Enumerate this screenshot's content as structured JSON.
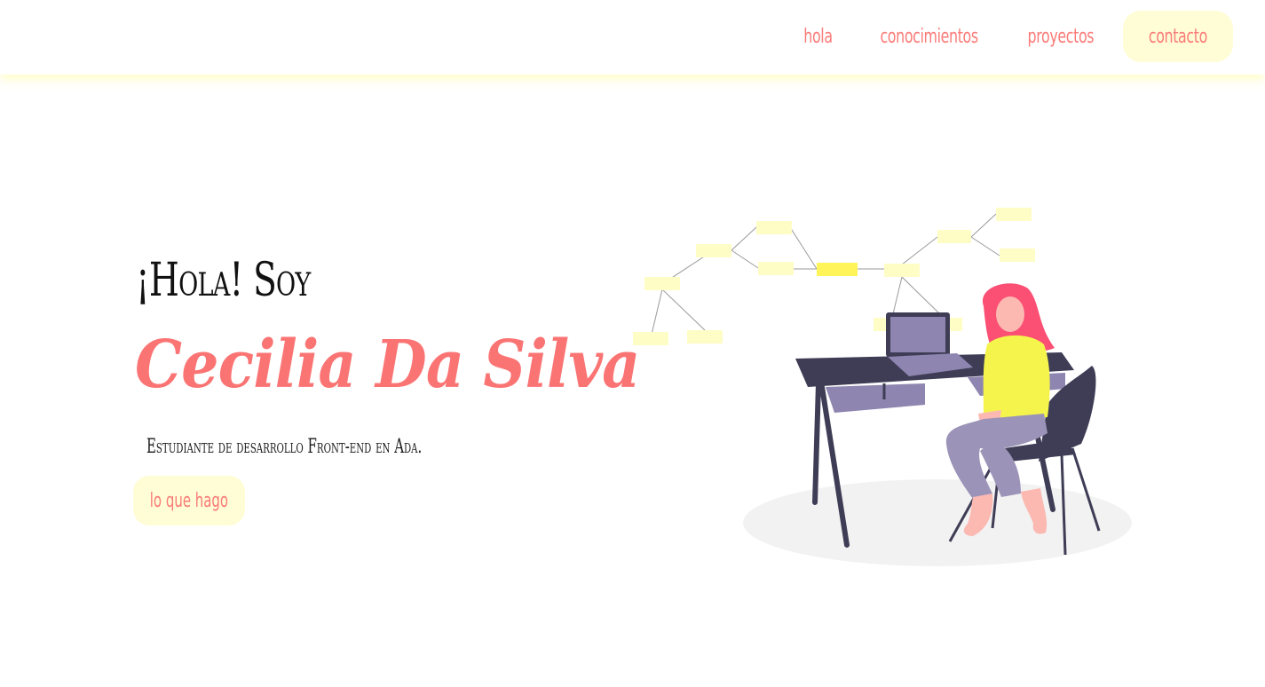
{
  "nav": {
    "items": [
      {
        "label": "hola"
      },
      {
        "label": "conocimientos"
      },
      {
        "label": "proyectos"
      },
      {
        "label": "contacto"
      }
    ]
  },
  "hero": {
    "greeting": "¡Hola! Soy",
    "name": "Cecilia Da Silva",
    "subtitle": "Estudiante de desarrollo Front-end en Ada.",
    "cta_label": "lo que hago"
  },
  "colors": {
    "accent": "#fb7474",
    "soft_yellow": "#fffdd6",
    "highlight_yellow": "#fff55a",
    "desk": "#3f3d56",
    "laptop": "#8e85b0"
  },
  "illustration": {
    "icon": "woman-at-desk-illustration"
  }
}
